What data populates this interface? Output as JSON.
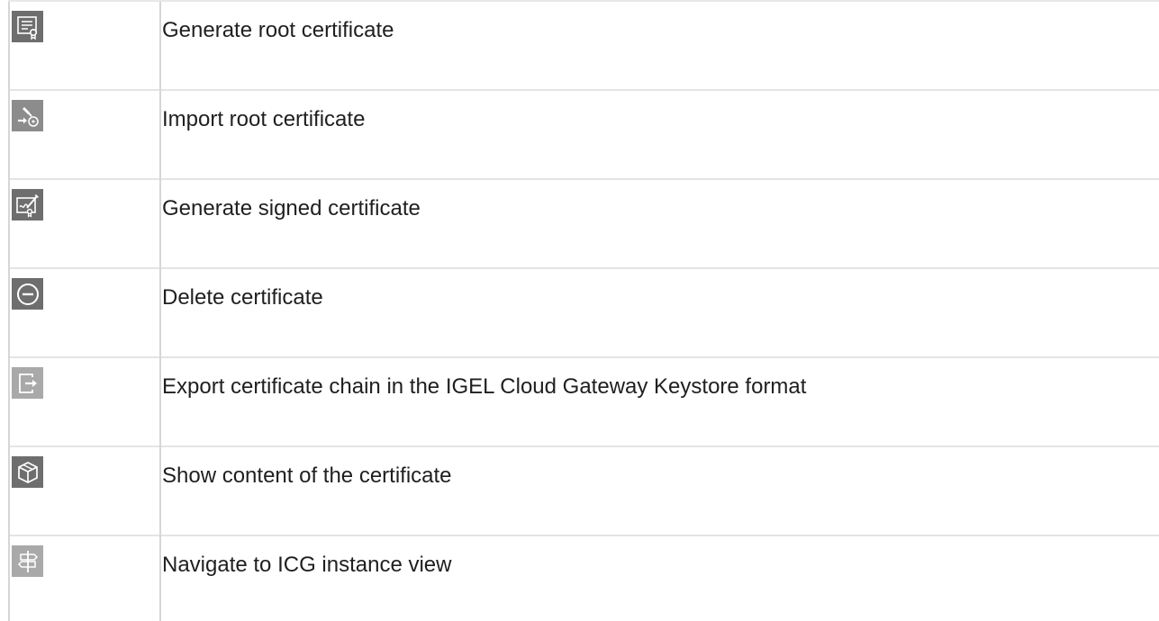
{
  "rows": [
    {
      "icon": "certificate-icon",
      "label": "Generate root certificate"
    },
    {
      "icon": "import-key-icon",
      "label": "Import root certificate"
    },
    {
      "icon": "signed-certificate-icon",
      "label": "Generate signed certificate"
    },
    {
      "icon": "delete-icon",
      "label": "Delete certificate"
    },
    {
      "icon": "export-icon",
      "label": "Export certificate chain in the IGEL Cloud Gateway Keystore format"
    },
    {
      "icon": "box-icon",
      "label": "Show content of the certificate"
    },
    {
      "icon": "signpost-icon",
      "label": "Navigate to ICG instance view"
    }
  ],
  "colors": {
    "icon_background": "#6e6e6e",
    "icon_foreground": "#ffffff",
    "grid_line": "#e4e4e4"
  }
}
